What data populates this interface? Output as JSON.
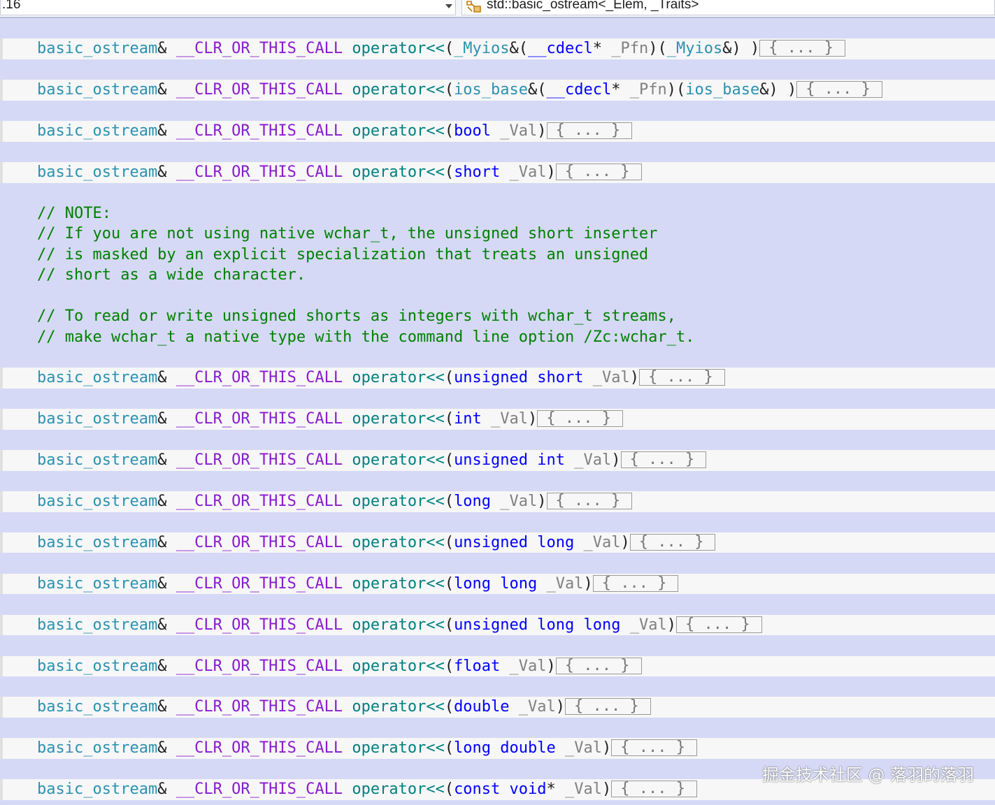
{
  "toolbar": {
    "line_number_fragment": ".16",
    "scope_label": "std::basic_ostream<_Elem, _Traits>"
  },
  "code_lines": [
    {
      "kind": "blank"
    },
    {
      "kind": "decl",
      "parts": [
        [
          "type",
          "basic_ostream"
        ],
        [
          "plain",
          "& "
        ],
        [
          "macro",
          "__CLR_OR_THIS_CALL"
        ],
        [
          "plain",
          " "
        ],
        [
          "fn",
          "operator<<"
        ],
        [
          "plain",
          "("
        ],
        [
          "type",
          "_Myios"
        ],
        [
          "plain",
          "&("
        ],
        [
          "kw",
          "__cdecl"
        ],
        [
          "plain",
          "* "
        ],
        [
          "param",
          "_Pfn"
        ],
        [
          "plain",
          ")("
        ],
        [
          "type",
          "_Myios"
        ],
        [
          "plain",
          "&) )"
        ]
      ],
      "fold": "{ ... }"
    },
    {
      "kind": "blank"
    },
    {
      "kind": "decl",
      "parts": [
        [
          "type",
          "basic_ostream"
        ],
        [
          "plain",
          "& "
        ],
        [
          "macro",
          "__CLR_OR_THIS_CALL"
        ],
        [
          "plain",
          " "
        ],
        [
          "fn",
          "operator<<"
        ],
        [
          "plain",
          "("
        ],
        [
          "type",
          "ios_base"
        ],
        [
          "plain",
          "&("
        ],
        [
          "kw",
          "__cdecl"
        ],
        [
          "plain",
          "* "
        ],
        [
          "param",
          "_Pfn"
        ],
        [
          "plain",
          ")("
        ],
        [
          "type",
          "ios_base"
        ],
        [
          "plain",
          "&) )"
        ]
      ],
      "fold": "{ ... }"
    },
    {
      "kind": "blank"
    },
    {
      "kind": "decl",
      "parts": [
        [
          "type",
          "basic_ostream"
        ],
        [
          "plain",
          "& "
        ],
        [
          "macro",
          "__CLR_OR_THIS_CALL"
        ],
        [
          "plain",
          " "
        ],
        [
          "fn",
          "operator<<"
        ],
        [
          "plain",
          "("
        ],
        [
          "kw",
          "bool"
        ],
        [
          "plain",
          " "
        ],
        [
          "param",
          "_Val"
        ],
        [
          "plain",
          ")"
        ]
      ],
      "fold": "{ ... }"
    },
    {
      "kind": "blank"
    },
    {
      "kind": "decl",
      "parts": [
        [
          "type",
          "basic_ostream"
        ],
        [
          "plain",
          "& "
        ],
        [
          "macro",
          "__CLR_OR_THIS_CALL"
        ],
        [
          "plain",
          " "
        ],
        [
          "fn",
          "operator<<"
        ],
        [
          "plain",
          "("
        ],
        [
          "kw",
          "short"
        ],
        [
          "plain",
          " "
        ],
        [
          "param",
          "_Val"
        ],
        [
          "plain",
          ")"
        ]
      ],
      "fold": "{ ... }"
    },
    {
      "kind": "blank"
    },
    {
      "kind": "comment",
      "text": "// NOTE:"
    },
    {
      "kind": "comment",
      "text": "// If you are not using native wchar_t, the unsigned short inserter"
    },
    {
      "kind": "comment",
      "text": "// is masked by an explicit specialization that treats an unsigned"
    },
    {
      "kind": "comment",
      "text": "// short as a wide character."
    },
    {
      "kind": "blank"
    },
    {
      "kind": "comment",
      "text": "// To read or write unsigned shorts as integers with wchar_t streams,"
    },
    {
      "kind": "comment",
      "text": "// make wchar_t a native type with the command line option /Zc:wchar_t."
    },
    {
      "kind": "blank"
    },
    {
      "kind": "decl",
      "parts": [
        [
          "type",
          "basic_ostream"
        ],
        [
          "plain",
          "& "
        ],
        [
          "macro",
          "__CLR_OR_THIS_CALL"
        ],
        [
          "plain",
          " "
        ],
        [
          "fn",
          "operator<<"
        ],
        [
          "plain",
          "("
        ],
        [
          "kw",
          "unsigned short"
        ],
        [
          "plain",
          " "
        ],
        [
          "param",
          "_Val"
        ],
        [
          "plain",
          ")"
        ]
      ],
      "fold": "{ ... }"
    },
    {
      "kind": "blank"
    },
    {
      "kind": "decl",
      "parts": [
        [
          "type",
          "basic_ostream"
        ],
        [
          "plain",
          "& "
        ],
        [
          "macro",
          "__CLR_OR_THIS_CALL"
        ],
        [
          "plain",
          " "
        ],
        [
          "fn",
          "operator<<"
        ],
        [
          "plain",
          "("
        ],
        [
          "kw",
          "int"
        ],
        [
          "plain",
          " "
        ],
        [
          "param",
          "_Val"
        ],
        [
          "plain",
          ")"
        ]
      ],
      "fold": "{ ... }"
    },
    {
      "kind": "blank"
    },
    {
      "kind": "decl",
      "parts": [
        [
          "type",
          "basic_ostream"
        ],
        [
          "plain",
          "& "
        ],
        [
          "macro",
          "__CLR_OR_THIS_CALL"
        ],
        [
          "plain",
          " "
        ],
        [
          "fn",
          "operator<<"
        ],
        [
          "plain",
          "("
        ],
        [
          "kw",
          "unsigned int"
        ],
        [
          "plain",
          " "
        ],
        [
          "param",
          "_Val"
        ],
        [
          "plain",
          ")"
        ]
      ],
      "fold": "{ ... }"
    },
    {
      "kind": "blank"
    },
    {
      "kind": "decl",
      "parts": [
        [
          "type",
          "basic_ostream"
        ],
        [
          "plain",
          "& "
        ],
        [
          "macro",
          "__CLR_OR_THIS_CALL"
        ],
        [
          "plain",
          " "
        ],
        [
          "fn",
          "operator<<"
        ],
        [
          "plain",
          "("
        ],
        [
          "kw",
          "long"
        ],
        [
          "plain",
          " "
        ],
        [
          "param",
          "_Val"
        ],
        [
          "plain",
          ")"
        ]
      ],
      "fold": "{ ... }"
    },
    {
      "kind": "blank"
    },
    {
      "kind": "decl",
      "parts": [
        [
          "type",
          "basic_ostream"
        ],
        [
          "plain",
          "& "
        ],
        [
          "macro",
          "__CLR_OR_THIS_CALL"
        ],
        [
          "plain",
          " "
        ],
        [
          "fn",
          "operator<<"
        ],
        [
          "plain",
          "("
        ],
        [
          "kw",
          "unsigned long"
        ],
        [
          "plain",
          " "
        ],
        [
          "param",
          "_Val"
        ],
        [
          "plain",
          ")"
        ]
      ],
      "fold": "{ ... }"
    },
    {
      "kind": "blank"
    },
    {
      "kind": "decl",
      "parts": [
        [
          "type",
          "basic_ostream"
        ],
        [
          "plain",
          "& "
        ],
        [
          "macro",
          "__CLR_OR_THIS_CALL"
        ],
        [
          "plain",
          " "
        ],
        [
          "fn",
          "operator<<"
        ],
        [
          "plain",
          "("
        ],
        [
          "kw",
          "long long"
        ],
        [
          "plain",
          " "
        ],
        [
          "param",
          "_Val"
        ],
        [
          "plain",
          ")"
        ]
      ],
      "fold": "{ ... }"
    },
    {
      "kind": "blank"
    },
    {
      "kind": "decl",
      "parts": [
        [
          "type",
          "basic_ostream"
        ],
        [
          "plain",
          "& "
        ],
        [
          "macro",
          "__CLR_OR_THIS_CALL"
        ],
        [
          "plain",
          " "
        ],
        [
          "fn",
          "operator<<"
        ],
        [
          "plain",
          "("
        ],
        [
          "kw",
          "unsigned long long"
        ],
        [
          "plain",
          " "
        ],
        [
          "param",
          "_Val"
        ],
        [
          "plain",
          ")"
        ]
      ],
      "fold": "{ ... }"
    },
    {
      "kind": "blank"
    },
    {
      "kind": "decl",
      "parts": [
        [
          "type",
          "basic_ostream"
        ],
        [
          "plain",
          "& "
        ],
        [
          "macro",
          "__CLR_OR_THIS_CALL"
        ],
        [
          "plain",
          " "
        ],
        [
          "fn",
          "operator<<"
        ],
        [
          "plain",
          "("
        ],
        [
          "kw",
          "float"
        ],
        [
          "plain",
          " "
        ],
        [
          "param",
          "_Val"
        ],
        [
          "plain",
          ")"
        ]
      ],
      "fold": "{ ... }"
    },
    {
      "kind": "blank"
    },
    {
      "kind": "decl",
      "parts": [
        [
          "type",
          "basic_ostream"
        ],
        [
          "plain",
          "& "
        ],
        [
          "macro",
          "__CLR_OR_THIS_CALL"
        ],
        [
          "plain",
          " "
        ],
        [
          "fn",
          "operator<<"
        ],
        [
          "plain",
          "("
        ],
        [
          "kw",
          "double"
        ],
        [
          "plain",
          " "
        ],
        [
          "param",
          "_Val"
        ],
        [
          "plain",
          ")"
        ]
      ],
      "fold": "{ ... }"
    },
    {
      "kind": "blank"
    },
    {
      "kind": "decl",
      "parts": [
        [
          "type",
          "basic_ostream"
        ],
        [
          "plain",
          "& "
        ],
        [
          "macro",
          "__CLR_OR_THIS_CALL"
        ],
        [
          "plain",
          " "
        ],
        [
          "fn",
          "operator<<"
        ],
        [
          "plain",
          "("
        ],
        [
          "kw",
          "long double"
        ],
        [
          "plain",
          " "
        ],
        [
          "param",
          "_Val"
        ],
        [
          "plain",
          ")"
        ]
      ],
      "fold": "{ ... }"
    },
    {
      "kind": "blank"
    },
    {
      "kind": "decl",
      "parts": [
        [
          "type",
          "basic_ostream"
        ],
        [
          "plain",
          "& "
        ],
        [
          "macro",
          "__CLR_OR_THIS_CALL"
        ],
        [
          "plain",
          " "
        ],
        [
          "fn",
          "operator<<"
        ],
        [
          "plain",
          "("
        ],
        [
          "kw",
          "const void"
        ],
        [
          "plain",
          "* "
        ],
        [
          "param",
          "_Val"
        ],
        [
          "plain",
          ")"
        ]
      ],
      "fold": "{ ... }"
    }
  ],
  "watermark": "掘金技术社区 @ 落羽的落羽",
  "colors": {
    "background": "#d5d9f5",
    "type": "#2b91af",
    "macro": "#8a1bce",
    "function": "#008080",
    "keyword": "#0000ff",
    "parameter": "#808080",
    "comment": "#008000"
  }
}
